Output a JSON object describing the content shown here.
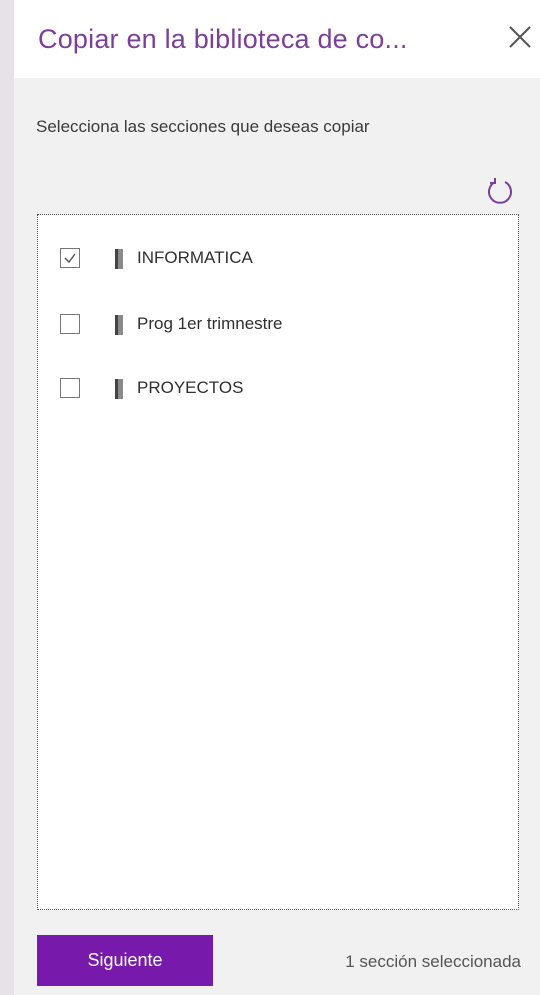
{
  "dialog": {
    "title": "Copiar en la biblioteca de co...",
    "instructions": "Selecciona las secciones que deseas copiar"
  },
  "icons": {
    "close": "close-icon",
    "refresh": "refresh-icon",
    "section": "section-tab-icon",
    "check": "checkmark-icon"
  },
  "sections": [
    {
      "label": "INFORMATICA",
      "checked": true
    },
    {
      "label": "Prog 1er trimnestre",
      "checked": false
    },
    {
      "label": "PROYECTOS",
      "checked": false
    }
  ],
  "footer": {
    "next_label": "Siguiente",
    "status": "1 sección seleccionada"
  },
  "colors": {
    "accent": "#7719aa",
    "title": "#7b3f98",
    "refresh": "#7b3f98",
    "section_tab": "#6b6b6b"
  }
}
